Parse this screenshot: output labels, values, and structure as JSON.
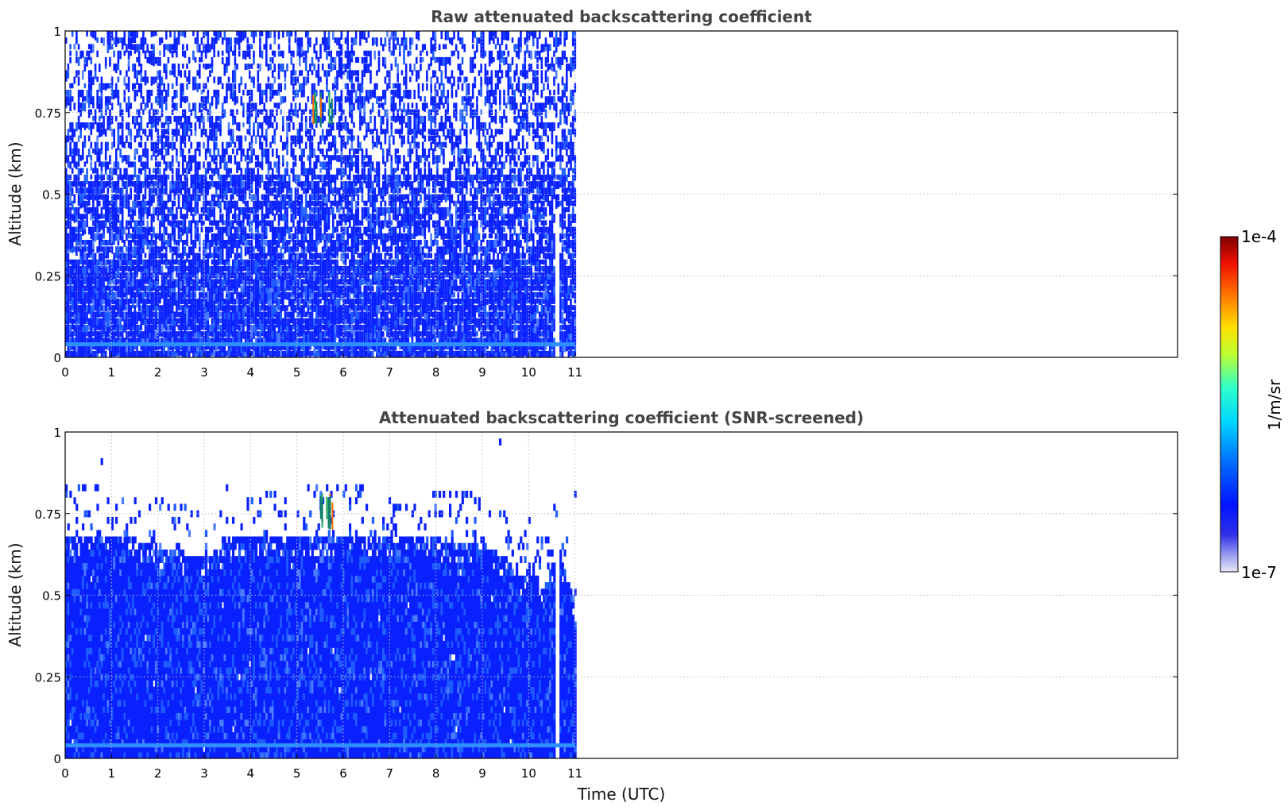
{
  "figure": {
    "xlabel": "Time (UTC)",
    "ylabel": "Altitude (km)"
  },
  "colorbar": {
    "max_label": "1e-4",
    "min_label": "1e-7",
    "unit": "1/m/sr",
    "scale": "log",
    "colormap": "jet",
    "min_color": "#e8e8f8",
    "max_color": "#800000"
  },
  "colors": {
    "primary_blue": "#0a21ff",
    "light_blue": "#1f5cff",
    "band_blue": "#2e90ff",
    "grid": "#bbbbbb",
    "title_gray": "#444444"
  },
  "chart_data": [
    {
      "type": "heatmap",
      "title": "Raw attenuated backscattering coefficient",
      "xlabel": "",
      "ylabel": "Altitude (km)",
      "xlim": [
        0,
        24
      ],
      "ylim": [
        0,
        1
      ],
      "xticks": [
        0,
        1,
        2,
        3,
        4,
        5,
        6,
        7,
        8,
        9,
        10,
        11
      ],
      "xtick_labels": [
        "0",
        "1",
        "2",
        "3",
        "4",
        "5",
        "6",
        "7",
        "8",
        "9",
        "10",
        "11"
      ],
      "yticks": [
        0,
        0.25,
        0.5,
        0.75,
        1
      ],
      "ytick_labels": [
        "0",
        "0.25",
        "0.5",
        "0.75",
        "1"
      ],
      "data_extent_hours": [
        0,
        11
      ],
      "grid": true,
      "features": [
        {
          "kind": "noise-field",
          "time_range": [
            0,
            11
          ],
          "altitude_range": [
            0,
            1
          ],
          "value": "~1e-6",
          "note": "dense near surface, sparser with height"
        },
        {
          "kind": "horizontal-band",
          "time_range": [
            0,
            11
          ],
          "altitude": 0.04,
          "value": "~3e-6"
        },
        {
          "kind": "cloud-streak",
          "time_range": [
            5.3,
            5.75
          ],
          "altitude_range": [
            0.7,
            0.82
          ],
          "value": "~1e-5"
        },
        {
          "kind": "gap",
          "time_range": [
            10.55,
            10.65
          ],
          "altitude_range": [
            0,
            0.45
          ]
        }
      ]
    },
    {
      "type": "heatmap",
      "title": "Attenuated backscattering coefficient (SNR-screened)",
      "xlabel": "Time (UTC)",
      "ylabel": "Altitude (km)",
      "xlim": [
        0,
        24
      ],
      "ylim": [
        0,
        1
      ],
      "xticks": [
        0,
        1,
        2,
        3,
        4,
        5,
        6,
        7,
        8,
        9,
        10,
        11
      ],
      "xtick_labels": [
        "0",
        "1",
        "2",
        "3",
        "4",
        "5",
        "6",
        "7",
        "8",
        "9",
        "10",
        "11"
      ],
      "yticks": [
        0,
        0.25,
        0.5,
        0.75,
        1
      ],
      "ytick_labels": [
        "0",
        "0.25",
        "0.5",
        "0.75",
        "1"
      ],
      "data_extent_hours": [
        0,
        11
      ],
      "grid": true,
      "layer_top_km": [
        [
          0,
          0.68
        ],
        [
          0.5,
          0.68
        ],
        [
          1,
          0.67
        ],
        [
          1.5,
          0.66
        ],
        [
          2,
          0.64
        ],
        [
          2.5,
          0.62
        ],
        [
          3,
          0.6
        ],
        [
          3.5,
          0.66
        ],
        [
          4,
          0.67
        ],
        [
          4.5,
          0.67
        ],
        [
          5,
          0.67
        ],
        [
          5.5,
          0.68
        ],
        [
          6,
          0.67
        ],
        [
          6.5,
          0.68
        ],
        [
          7,
          0.67
        ],
        [
          7.5,
          0.67
        ],
        [
          8,
          0.66
        ],
        [
          8.5,
          0.66
        ],
        [
          9,
          0.65
        ],
        [
          9.5,
          0.6
        ],
        [
          9.8,
          0.52
        ],
        [
          10,
          0.6
        ],
        [
          10.3,
          0.5
        ],
        [
          10.6,
          0.66
        ],
        [
          10.8,
          0.55
        ],
        [
          11,
          0.45
        ]
      ],
      "features": [
        {
          "kind": "aerosol-layer",
          "time_range": [
            0,
            11
          ],
          "altitude_range": [
            0,
            0.68
          ],
          "value": "~1e-6"
        },
        {
          "kind": "horizontal-band",
          "time_range": [
            0,
            11
          ],
          "altitude": 0.04,
          "value": "~3e-6"
        },
        {
          "kind": "cloud-streak",
          "time_range": [
            5.3,
            5.75
          ],
          "altitude_range": [
            0.7,
            0.82
          ],
          "value": "~1e-5"
        },
        {
          "kind": "scattered-returns",
          "time_range": [
            0,
            11
          ],
          "altitude_range": [
            0.68,
            0.98
          ]
        },
        {
          "kind": "gap",
          "time_range": [
            10.55,
            10.65
          ],
          "altitude_range": [
            0,
            0.65
          ]
        }
      ]
    }
  ]
}
